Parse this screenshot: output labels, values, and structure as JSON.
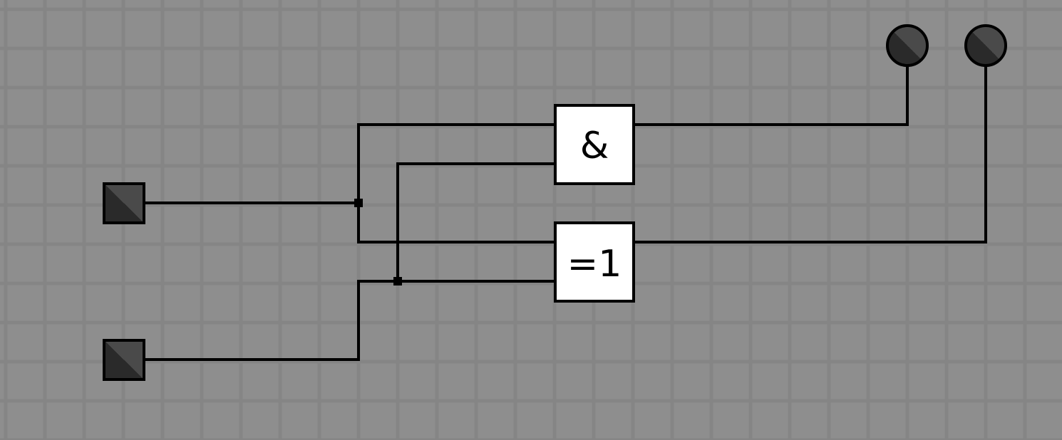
{
  "canvas": {
    "background_color": "#8e8e8e",
    "grid_line_color": "#858585",
    "wire_color": "#000000"
  },
  "inputs": [
    {
      "id": "input-a",
      "state": "off",
      "color": "#3a3a3a"
    },
    {
      "id": "input-b",
      "state": "off",
      "color": "#3a3a3a"
    }
  ],
  "gates": {
    "and_gate": {
      "label": "&"
    },
    "xor_gate": {
      "label": "=1"
    }
  },
  "outputs": [
    {
      "id": "output-and",
      "state": "off",
      "color": "#3a3a3a"
    },
    {
      "id": "output-xor",
      "state": "off",
      "color": "#3a3a3a"
    }
  ]
}
